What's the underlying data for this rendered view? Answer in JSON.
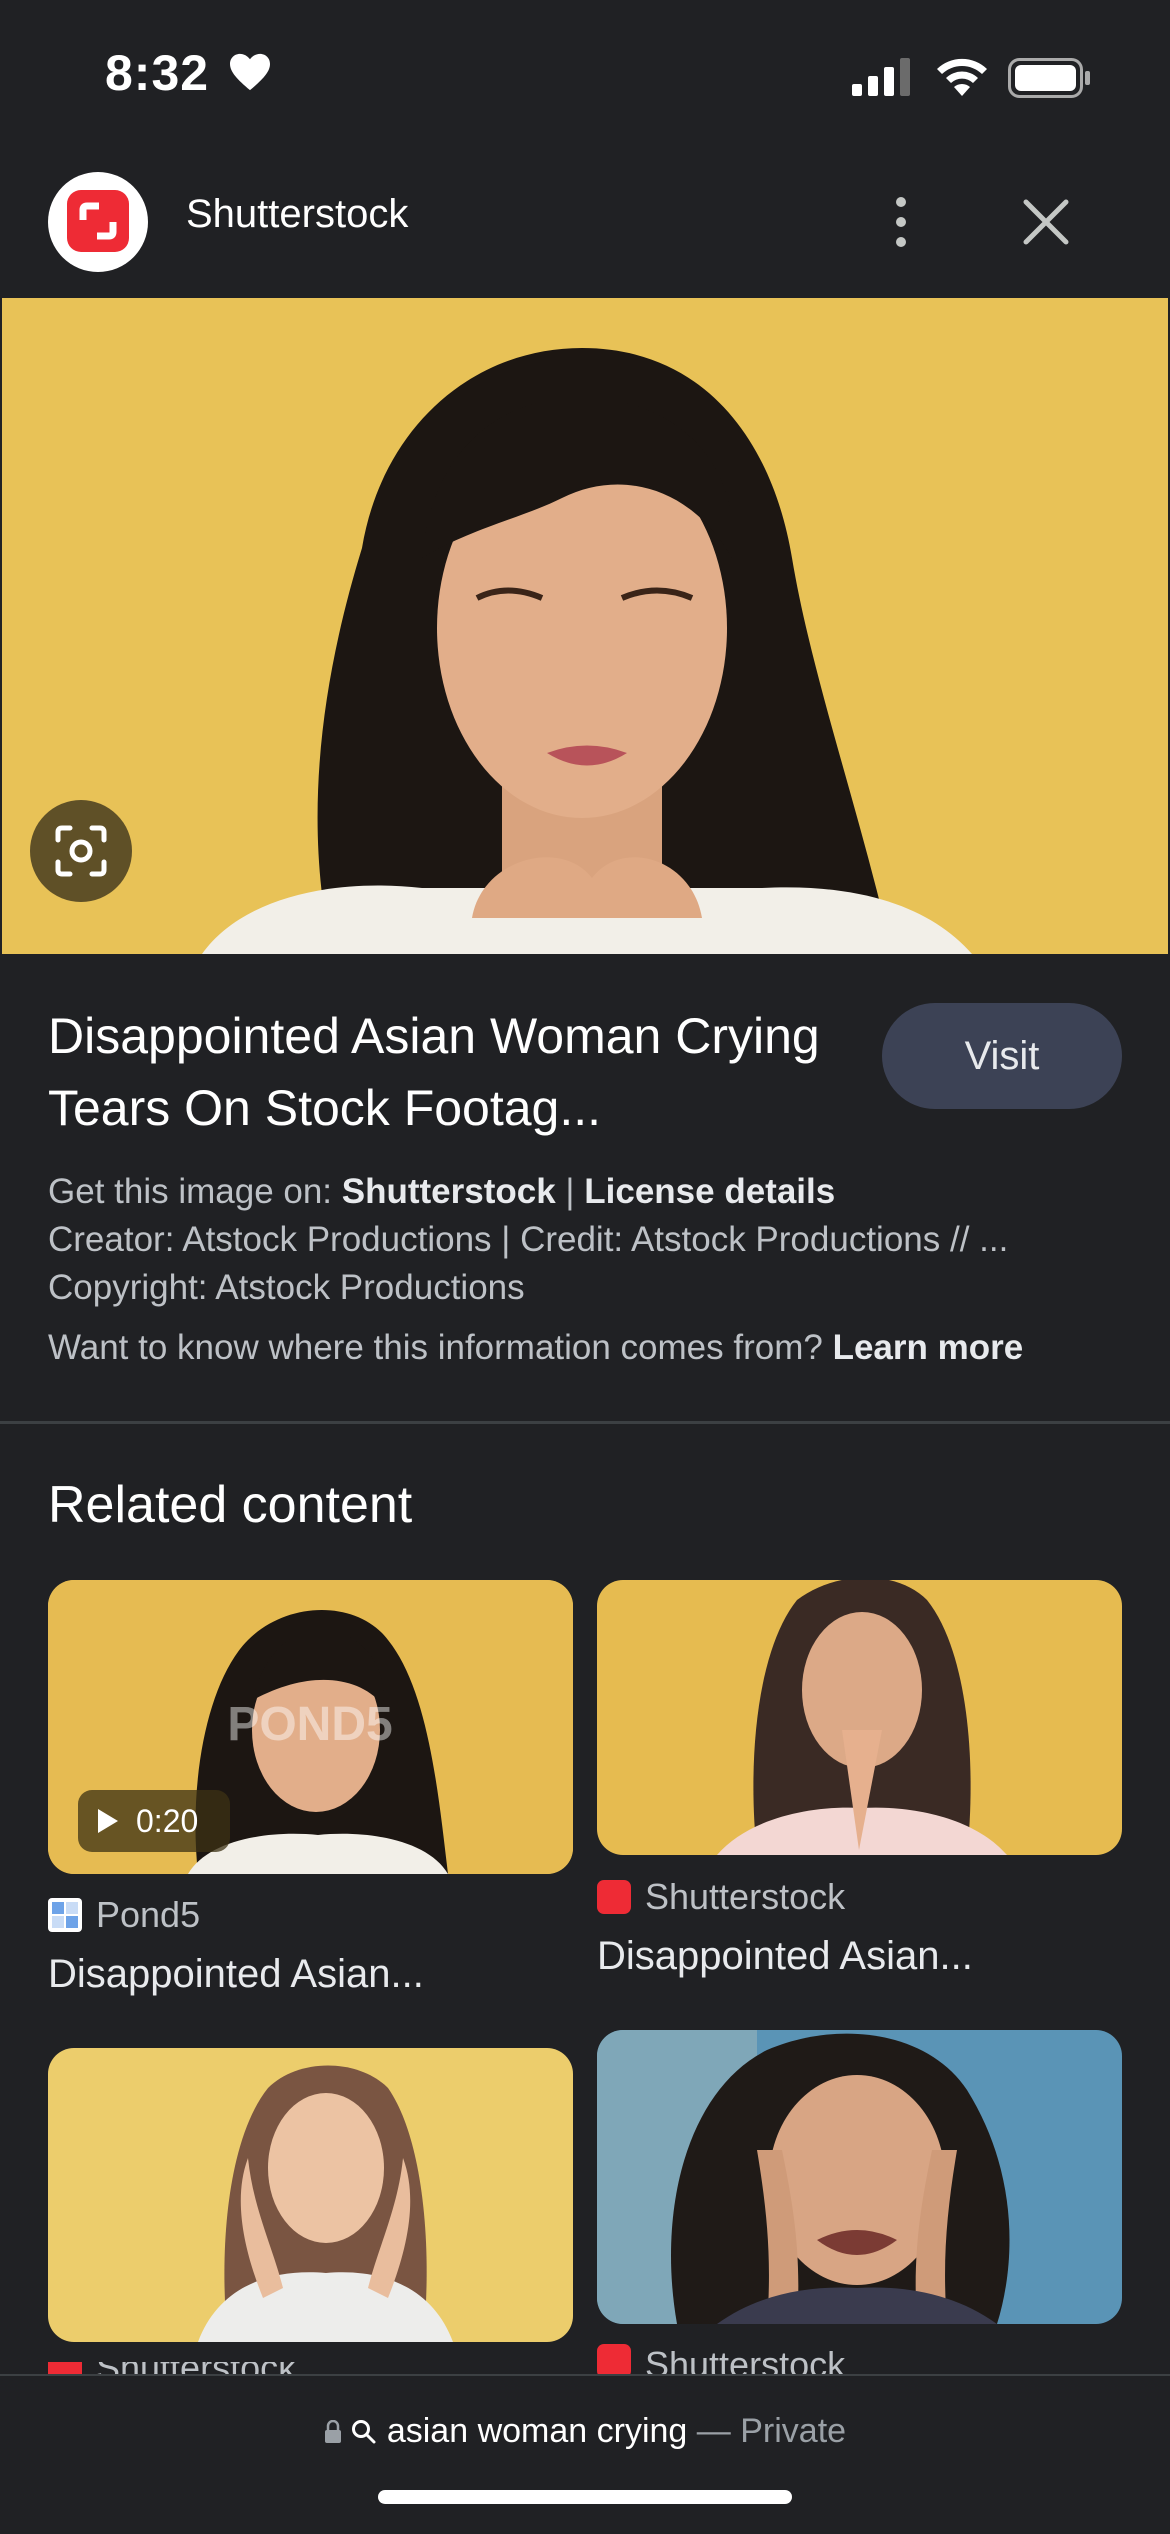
{
  "status_bar": {
    "time": "8:32"
  },
  "header": {
    "site_name": "Shutterstock"
  },
  "image": {
    "title": "Disappointed Asian Woman Crying Tears On Stock Footag...",
    "visit_label": "Visit",
    "get_prefix": "Get this image on: ",
    "get_site": "Shutterstock",
    "separator": " | ",
    "license_label": "License details",
    "creator_line": "Creator: Atstock Productions | Credit: Atstock Productions // ...",
    "copyright_line": "Copyright: Atstock Productions",
    "info_question": "Want to know where this information comes from? ",
    "learn_more": "Learn more"
  },
  "related": {
    "title": "Related content",
    "items": [
      {
        "source": "Pond5",
        "title": "Disappointed Asian...",
        "duration": "0:20",
        "watermark": "POND5"
      },
      {
        "source": "Shutterstock",
        "title": "Disappointed Asian..."
      },
      {
        "source": "Shutterstock",
        "title": ""
      },
      {
        "source": "Shutterstock",
        "title": ""
      }
    ]
  },
  "bottom": {
    "query": "asian woman crying",
    "mode": "— Private"
  },
  "colors": {
    "background": "#202124",
    "accent": "#ee2b35",
    "visit_button": "#3c4255"
  }
}
